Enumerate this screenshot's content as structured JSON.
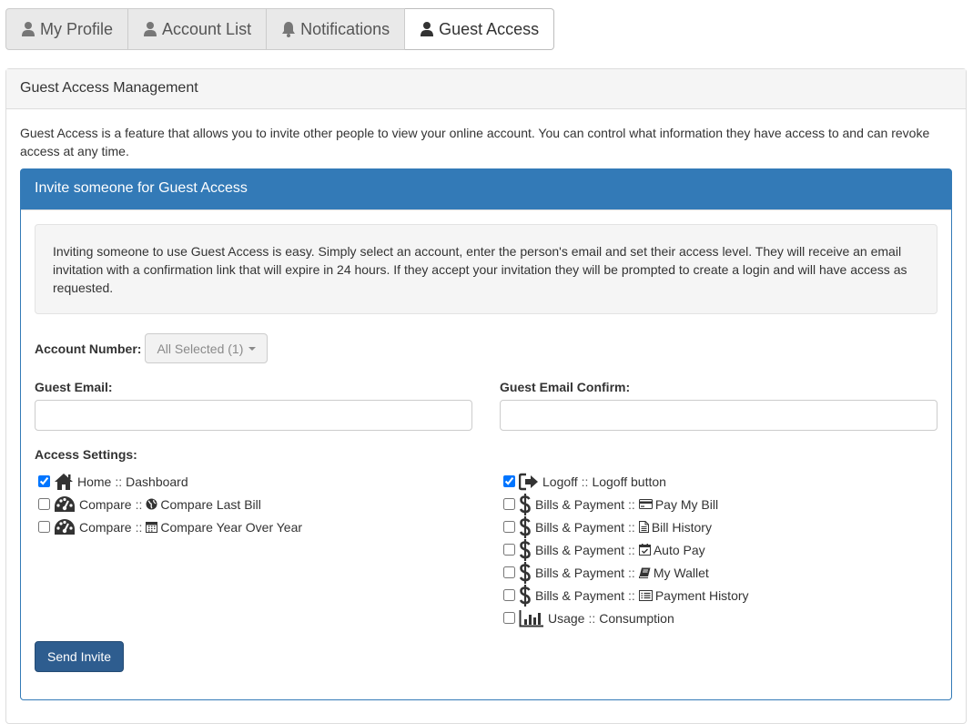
{
  "tabs": [
    {
      "label": "My Profile",
      "icon": "user-icon"
    },
    {
      "label": "Account List",
      "icon": "user-icon"
    },
    {
      "label": "Notifications",
      "icon": "bell-icon"
    },
    {
      "label": "Guest Access",
      "icon": "user-icon",
      "active": true
    }
  ],
  "panel": {
    "title": "Guest Access Management",
    "intro": "Guest Access is a feature that allows you to invite other people to view your online account. You can control what information they have access to and can revoke access at any time."
  },
  "invite": {
    "title": "Invite someone for Guest Access",
    "well_text": "Inviting someone to use Guest Access is easy. Simply select an account, enter the person's email and set their access level. They will receive an email invitation with a confirmation link that will expire in 24 hours. If they accept your invitation they will be prompted to create a login and will have access as requested.",
    "account_label": "Account Number:",
    "account_selected": "All Selected (1)",
    "guest_email_label": "Guest Email:",
    "guest_email_value": "",
    "guest_email_confirm_label": "Guest Email Confirm:",
    "guest_email_confirm_value": "",
    "access_label": "Access Settings:",
    "separator": "::",
    "left_items": [
      {
        "section": "Home",
        "feature": "Dashboard",
        "checked": true,
        "section_icon": "home-icon",
        "feature_icon": ""
      },
      {
        "section": "Compare",
        "feature": "Compare Last Bill",
        "checked": false,
        "section_icon": "dashboard-icon",
        "feature_icon": "globe-icon"
      },
      {
        "section": "Compare",
        "feature": "Compare Year Over Year",
        "checked": false,
        "section_icon": "dashboard-icon",
        "feature_icon": "calendar-icon"
      }
    ],
    "right_items": [
      {
        "section": "Logoff",
        "feature": "Logoff button",
        "checked": true,
        "section_icon": "logout-icon",
        "feature_icon": ""
      },
      {
        "section": "Bills & Payment",
        "feature": "Pay My Bill",
        "checked": false,
        "section_icon": "dollar-icon",
        "feature_icon": "credit-card-icon"
      },
      {
        "section": "Bills & Payment",
        "feature": "Bill History",
        "checked": false,
        "section_icon": "dollar-icon",
        "feature_icon": "file-text-icon"
      },
      {
        "section": "Bills & Payment",
        "feature": "Auto Pay",
        "checked": false,
        "section_icon": "dollar-icon",
        "feature_icon": "calendar-check-icon"
      },
      {
        "section": "Bills & Payment",
        "feature": "My Wallet",
        "checked": false,
        "section_icon": "dollar-icon",
        "feature_icon": "book-icon"
      },
      {
        "section": "Bills & Payment",
        "feature": "Payment History",
        "checked": false,
        "section_icon": "dollar-icon",
        "feature_icon": "list-alt-icon"
      },
      {
        "section": "Usage",
        "feature": "Consumption",
        "checked": false,
        "section_icon": "bar-chart-icon",
        "feature_icon": ""
      }
    ],
    "send_label": "Send Invite"
  },
  "colors": {
    "primary": "#337ab7",
    "button": "#2e5d8f",
    "panel_heading": "#f5f5f5"
  }
}
